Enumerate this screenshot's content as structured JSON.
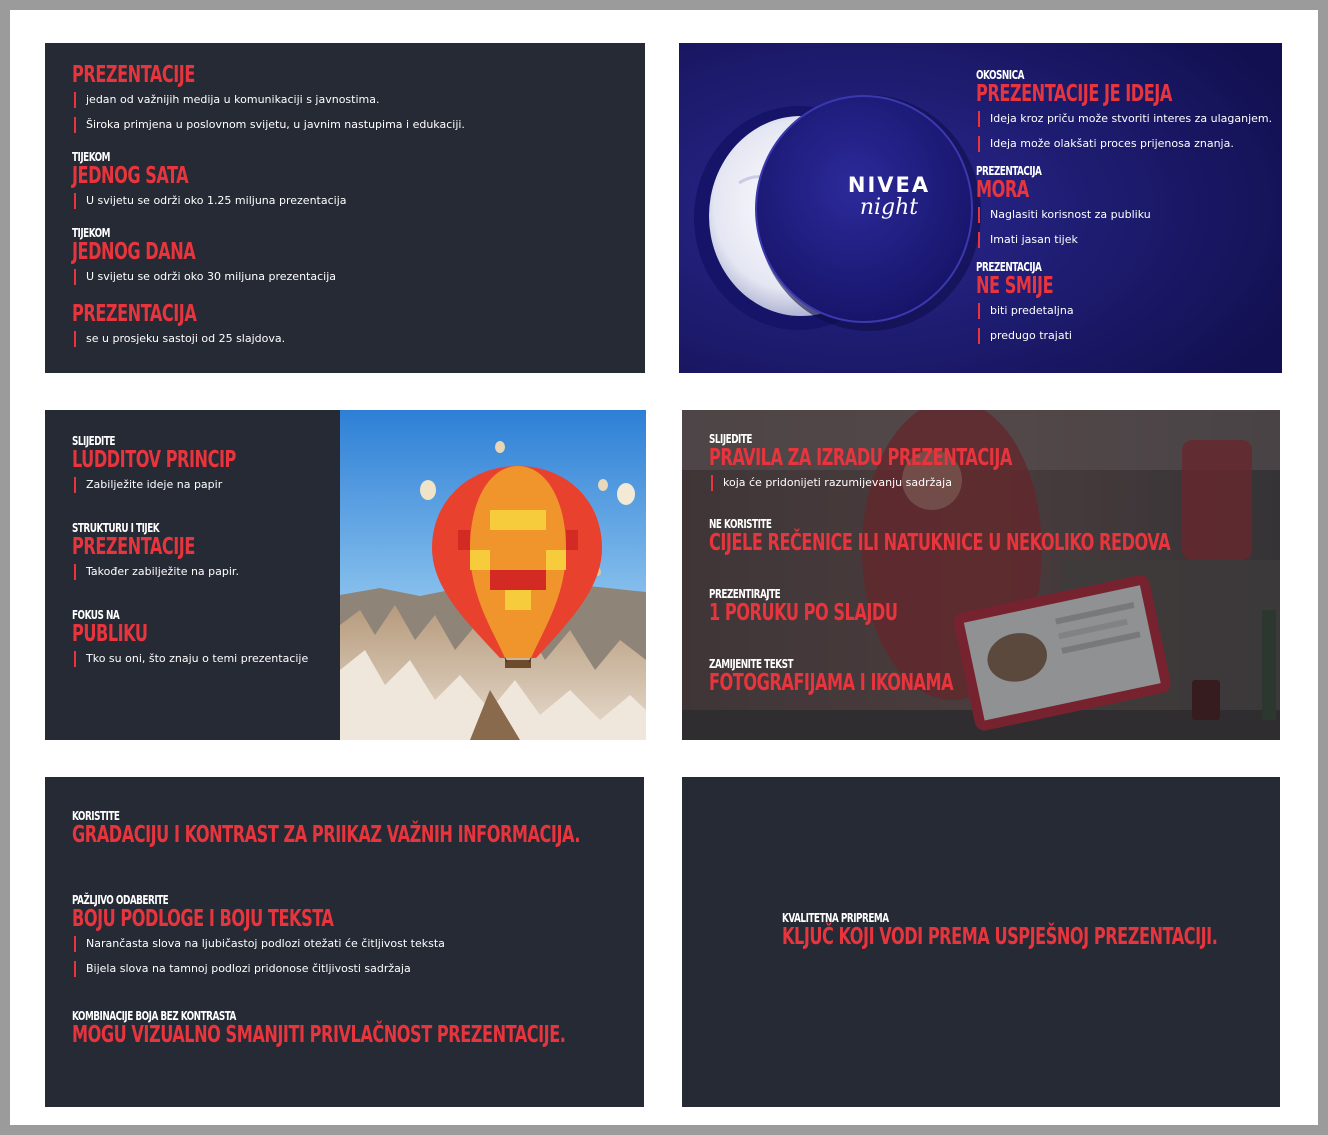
{
  "slide1": {
    "groups": [
      {
        "eyebrow": "",
        "heading": "PREZENTACIJE",
        "bullets": [
          "jedan od važnijih medija u komunikaciji s javnostima.",
          "Široka primjena u poslovnom svijetu, u javnim nastupima i edukaciji."
        ]
      },
      {
        "eyebrow": "TIJEKOM",
        "heading": "JEDNOG SATA",
        "bullets": [
          "U svijetu se održi oko 1.25 miljuna prezentacija"
        ]
      },
      {
        "eyebrow": "TIJEKOM",
        "heading": "JEDNOG DANA",
        "bullets": [
          "U svijetu se održi oko 30 miljuna prezentacija"
        ]
      },
      {
        "eyebrow": "",
        "heading": "PREZENTACIJA",
        "bullets": [
          "se u prosjeku sastoji od 25 slajdova."
        ]
      }
    ]
  },
  "slide2": {
    "logo_brand": "NIVEA",
    "logo_sub": "night",
    "groups": [
      {
        "eyebrow": "OKOSNICA",
        "heading": "PREZENTACIJE JE IDEJA",
        "bullets": [
          "Ideja kroz priču može stvoriti interes za ulaganjem.",
          "Ideja može olakšati proces prijenosa znanja."
        ]
      },
      {
        "eyebrow": "PREZENTACIJA",
        "heading": "MORA",
        "bullets": [
          "Naglasiti korisnost za publiku",
          "Imati jasan tijek"
        ]
      },
      {
        "eyebrow": "PREZENTACIJA",
        "heading": "NE SMIJE",
        "bullets": [
          "biti predetaljna",
          "predugo trajati"
        ]
      }
    ]
  },
  "slide3": {
    "groups": [
      {
        "eyebrow": "SLIJEDITE",
        "heading": "LUDDITOV PRINCIP",
        "bullets": [
          "Zabilježite ideje na papir"
        ]
      },
      {
        "eyebrow": "STRUKTURU I TIJEK",
        "heading": "PREZENTACIJE",
        "bullets": [
          "Također zabilježite na papir."
        ]
      },
      {
        "eyebrow": "FOKUS NA",
        "heading": "PUBLIKU",
        "bullets": [
          "Tko su oni, što znaju o temi prezentacije"
        ]
      }
    ]
  },
  "slide4": {
    "groups": [
      {
        "eyebrow": "SLIJEDITE",
        "heading": "PRAVILA ZA IZRADU PREZENTACIJA",
        "bullets": [
          "koja će pridonijeti razumijevanju sadržaja"
        ]
      },
      {
        "eyebrow": "NE KORISTITE",
        "heading": "CIJELE REČENICE ILI NATUKNICE U NEKOLIKO REDOVA",
        "bullets": []
      },
      {
        "eyebrow": "PREZENTIRAJTE",
        "heading": "1 PORUKU PO SLAJDU",
        "bullets": []
      },
      {
        "eyebrow": "ZAMIJENITE TEKST",
        "heading": "FOTOGRAFIJAMA I IKONAMA",
        "bullets": []
      }
    ]
  },
  "slide5": {
    "groups": [
      {
        "eyebrow": "KORISTITE",
        "heading": "GRADACIJU I KONTRAST ZA PRIIKAZ VAŽNIH INFORMACIJA.",
        "bullets": []
      },
      {
        "eyebrow": "PAŽLJIVO ODABERITE",
        "heading": "BOJU PODLOGE I BOJU TEKSTA",
        "bullets": [
          "Narančasta slova na ljubičastoj podlozi otežati će čitljivost teksta",
          "Bijela slova na tamnoj podlozi pridonose čitljivosti sadržaja"
        ]
      },
      {
        "eyebrow": "KOMBINACIJE BOJA BEZ KONTRASTA",
        "heading": "MOGU VIZUALNO SMANJITI PRIVLAČNOST PREZENTACIJE.",
        "bullets": []
      }
    ]
  },
  "slide6": {
    "groups": [
      {
        "eyebrow": "KVALITETNA PRIPREMA",
        "heading": "KLJUČ KOJI VODI PREMA USPJEŠNOJ PREZENTACIJI.",
        "bullets": []
      }
    ]
  },
  "colors": {
    "slide_bg": "#252a35",
    "accent_red": "#e8343c",
    "nivea_blue": "#1b1a6a",
    "text_white": "#ffffff"
  }
}
